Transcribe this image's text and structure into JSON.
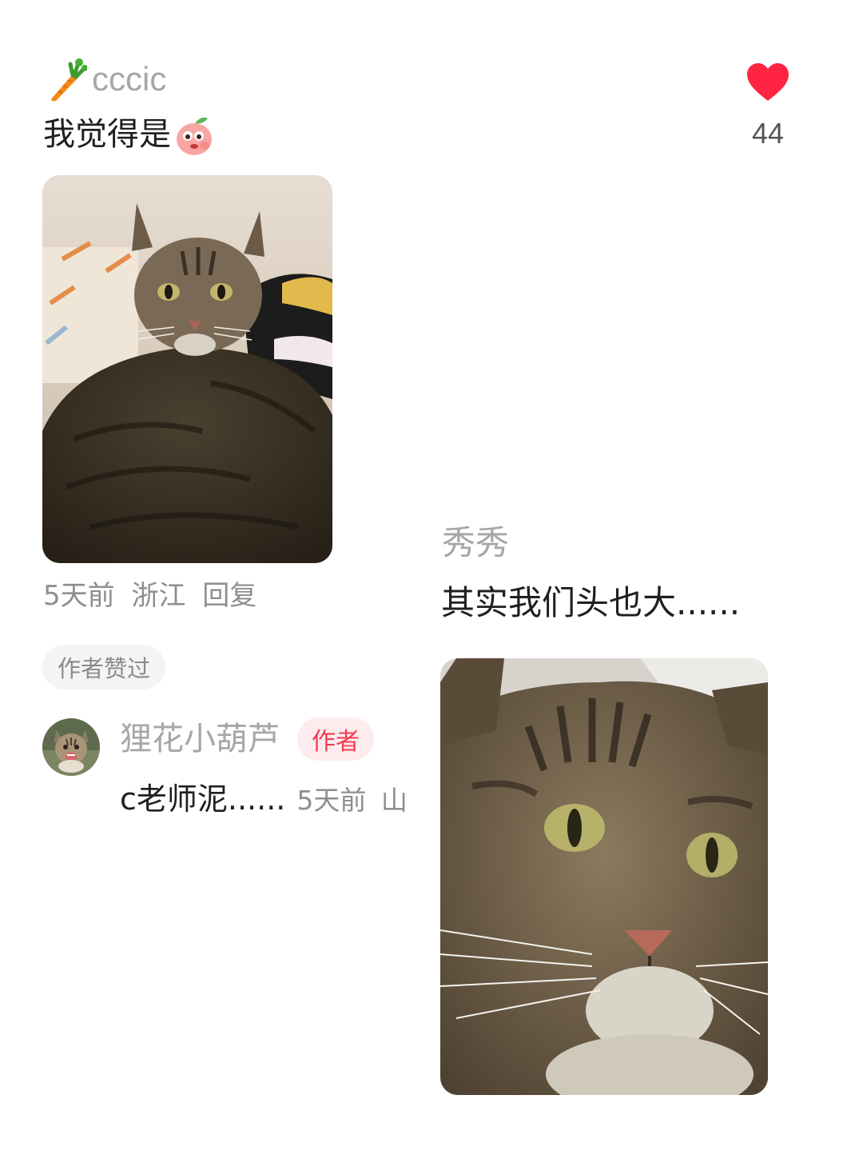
{
  "comment": {
    "username": "cccic",
    "text": "我觉得是",
    "like_count": "44",
    "time": "5天前",
    "location": "浙江",
    "reply_label": "回复",
    "author_liked_label": "作者赞过"
  },
  "reply": {
    "username": "狸花小葫芦",
    "author_tag": "作者",
    "text": "c老师泥......",
    "time": "5天前",
    "location": "山"
  },
  "second_comment": {
    "username": "秀秀",
    "text": "其实我们头也大......"
  },
  "colors": {
    "like": "#ff2442",
    "author_tag_bg": "#fdebed",
    "author_tag_text": "#f03c52",
    "muted_text": "#8e8e8e",
    "primary_text": "#1f1f1f"
  },
  "icons": {
    "username_badge": "carrot-icon",
    "comment_emoji": "peach-sticker-icon",
    "like": "heart-icon"
  }
}
